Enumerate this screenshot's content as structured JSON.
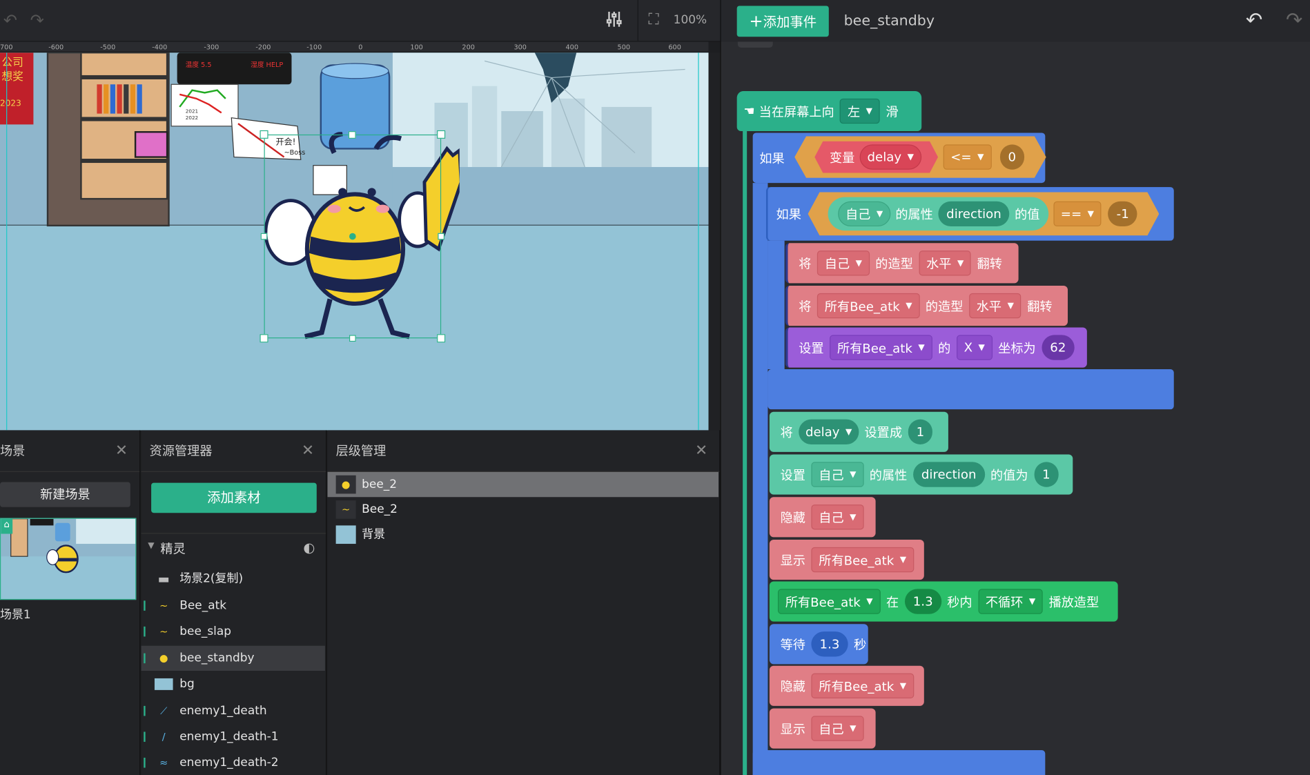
{
  "toolbar": {
    "zoom": "100%",
    "add_event_label": "添加事件",
    "sprite_name": "bee_standby"
  },
  "ruler": {
    "labels": [
      "700",
      "-600",
      "-500",
      "-400",
      "-300",
      "-200",
      "-100",
      "0",
      "100",
      "200",
      "300",
      "400",
      "500",
      "600"
    ]
  },
  "stage": {
    "banner_lines": [
      "公司",
      "想奖",
      "2023"
    ],
    "board_text_1": "温度 5.5",
    "board_text_2": "湿度 HELP",
    "chart_legend": [
      "2021",
      "2022"
    ],
    "note_text_1": "开会!",
    "note_text_2": "~Boss"
  },
  "scene_panel": {
    "title": "场景",
    "new_scene_label": "新建场景",
    "scene_name": "场景1"
  },
  "asset_panel": {
    "title": "资源管理器",
    "add_asset_label": "添加素材",
    "group_label": "精灵",
    "items": [
      "场景2(复制)",
      "Bee_atk",
      "bee_slap",
      "bee_standby",
      "bg",
      "enemy1_death",
      "enemy1_death-1",
      "enemy1_death-2"
    ]
  },
  "layer_panel": {
    "title": "层级管理",
    "items": [
      "bee_2",
      "Bee_2",
      "背景"
    ]
  },
  "code": {
    "hat": {
      "prefix": "当在屏幕上向",
      "dir": "左",
      "suffix": "滑"
    },
    "if1": {
      "label": "如果",
      "var_word": "变量",
      "var_name": "delay",
      "op": "<=",
      "value": "0"
    },
    "if2": {
      "label": "如果",
      "target": "自己",
      "prop_word": "的属性",
      "prop": "direction",
      "value_word": "的值",
      "op": "==",
      "value": "-1"
    },
    "flip1": {
      "w1": "将",
      "target": "自己",
      "w2": "的造型",
      "axis": "水平",
      "w3": "翻转"
    },
    "flip2": {
      "w1": "将",
      "target": "所有Bee_atk",
      "w2": "的造型",
      "axis": "水平",
      "w3": "翻转"
    },
    "setx": {
      "w1": "设置",
      "target": "所有Bee_atk",
      "w2": "的",
      "coord": "X",
      "w3": "坐标为",
      "value": "62"
    },
    "setdelay": {
      "w1": "将",
      "var": "delay",
      "w2": "设置成",
      "value": "1"
    },
    "setprop": {
      "w1": "设置",
      "target": "自己",
      "w2": "的属性",
      "prop": "direction",
      "w3": "的值为",
      "value": "1"
    },
    "hide1": {
      "w1": "隐藏",
      "target": "自己"
    },
    "show1": {
      "w1": "显示",
      "target": "所有Bee_atk"
    },
    "play": {
      "target": "所有Bee_atk",
      "w1": "在",
      "secs": "1.3",
      "w2": "秒内",
      "loop": "不循环",
      "w3": "播放造型"
    },
    "wait": {
      "w1": "等待",
      "secs": "1.3",
      "w2": "秒"
    },
    "hide2": {
      "w1": "隐藏",
      "target": "所有Bee_atk"
    },
    "show2": {
      "w1": "显示",
      "target": "自己"
    }
  },
  "colors": {
    "accent": "#2bb08a",
    "if_block": "#4d7ee0",
    "looks": "#e07e86",
    "motion": "#9b5dd9",
    "sensing": "#5bc8a6",
    "control": "#2bbf6a"
  }
}
